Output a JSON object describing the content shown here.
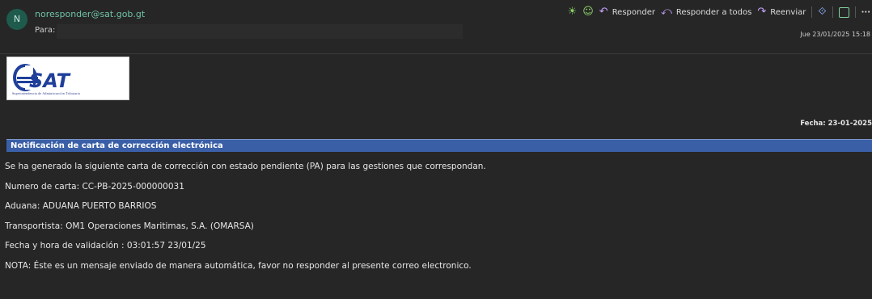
{
  "email": {
    "avatar_initial": "N",
    "sender": "noresponder@sat.gob.gt",
    "to_label": "Para:",
    "date": "Jue 23/01/2025 15:18"
  },
  "toolbar": {
    "icons": [
      "sun-icon",
      "emoji-icon",
      "reply-icon",
      "reply-all-icon",
      "forward-icon",
      "translate-icon",
      "apps-icon",
      "more-icon"
    ],
    "reply_label": "Responder",
    "reply_all_label": "Responder a todos",
    "forward_label": "Reenviar",
    "more_label": "···"
  },
  "logo": {
    "text": "SAT",
    "subtitle": "Superintendencia de Administración Tributaria"
  },
  "message": {
    "fecha": "Fecha: 23-01-2025",
    "title": "Notificación de carta de corrección electrónica",
    "lines": [
      "Se ha generado la siguiente carta de corrección con estado pendiente (PA) para las gestiones que correspondan.",
      "Numero de carta: CC-PB-2025-000000031",
      "Aduana: ADUANA PUERTO BARRIOS",
      "Transportista: OM1 Operaciones Maritimas, S.A. (OMARSA)",
      "Fecha y hora de validación : 03:01:57 23/01/25",
      "NOTA: Éste es un mensaje enviado de manera automática, favor no responder al presente correo electronico."
    ]
  },
  "colors": {
    "background": "#262626",
    "sender": "#6fc2a8",
    "title_bar": "#3a5fa7",
    "logo_blue": "#1f3f9a"
  }
}
